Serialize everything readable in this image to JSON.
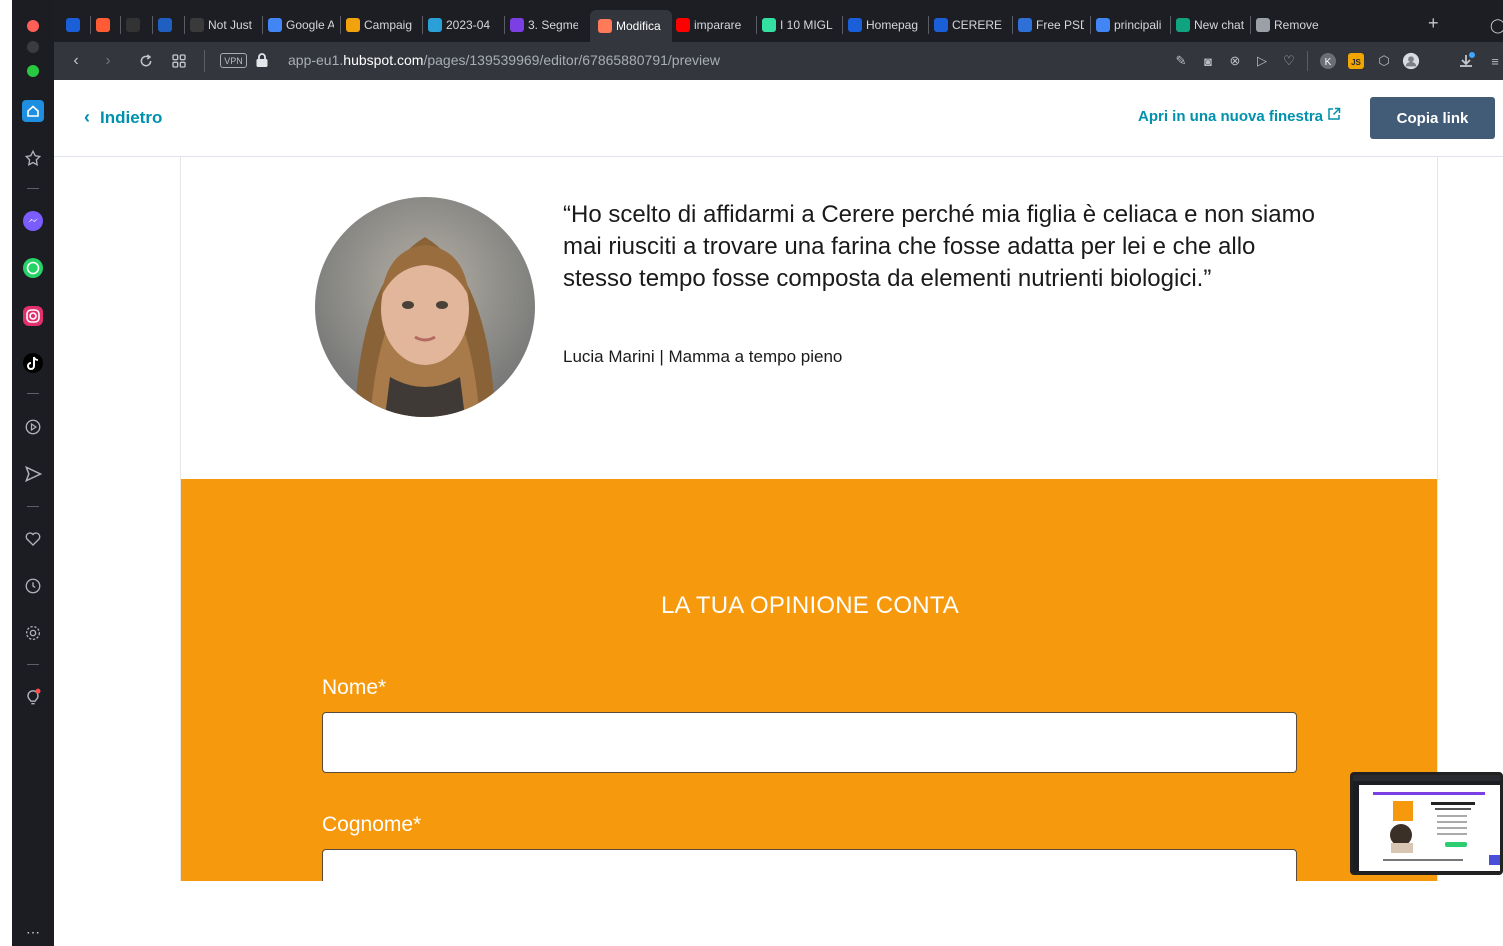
{
  "browser": {
    "tabs": [
      {
        "label": "",
        "color": "#1a5fd8"
      },
      {
        "label": "",
        "color": "#ff5c35"
      },
      {
        "label": "",
        "color": "#333333"
      },
      {
        "label": "",
        "color": "#1f5fbf"
      },
      {
        "label": "Not Just",
        "color": "#3a3a3a"
      },
      {
        "label": "Google A",
        "color": "#4285f4"
      },
      {
        "label": "Campaig",
        "color": "#f2a20c"
      },
      {
        "label": "2023-04",
        "color": "#2a9fd8"
      },
      {
        "label": "3. Segme",
        "color": "#7b3fe4"
      },
      {
        "label": "Modifica",
        "color": "#ff7a59"
      },
      {
        "label": "imparare",
        "color": "#ff0000"
      },
      {
        "label": "I 10 MIGL",
        "color": "#34e0a1"
      },
      {
        "label": "Homepag",
        "color": "#1a5fd8"
      },
      {
        "label": "CERERE",
        "color": "#1a5fd8"
      },
      {
        "label": "Free PSD",
        "color": "#2f6fd8"
      },
      {
        "label": "principali",
        "color": "#4285f4"
      },
      {
        "label": "New chat",
        "color": "#10a37f"
      },
      {
        "label": "Remove",
        "color": "#9aa0a6"
      }
    ],
    "url_prefix": "app-eu1.",
    "url_domain": "hubspot.com",
    "url_path": "/pages/139539969/editor/67865880791/preview",
    "vpn_label": "VPN"
  },
  "preview_header": {
    "back_label": "Indietro",
    "open_new_label": "Apri in una nuova finestra",
    "copy_link_label": "Copia link"
  },
  "testimonial": {
    "quote": "“Ho scelto di affidarmi a Cerere perché mia figlia è celiaca e non siamo mai riusciti a trovare una farina che fosse adatta per lei e che allo stesso tempo fosse composta da elementi nutrienti biologici.”",
    "author": "Lucia Marini | Mamma a tempo pieno"
  },
  "form": {
    "title": "LA TUA OPINIONE CONTA",
    "fields": [
      {
        "label": "Nome*",
        "value": ""
      },
      {
        "label": "Cognome*",
        "value": ""
      }
    ]
  },
  "colors": {
    "accent": "#0091ae",
    "button": "#425b76",
    "orange": "#f7990c"
  }
}
